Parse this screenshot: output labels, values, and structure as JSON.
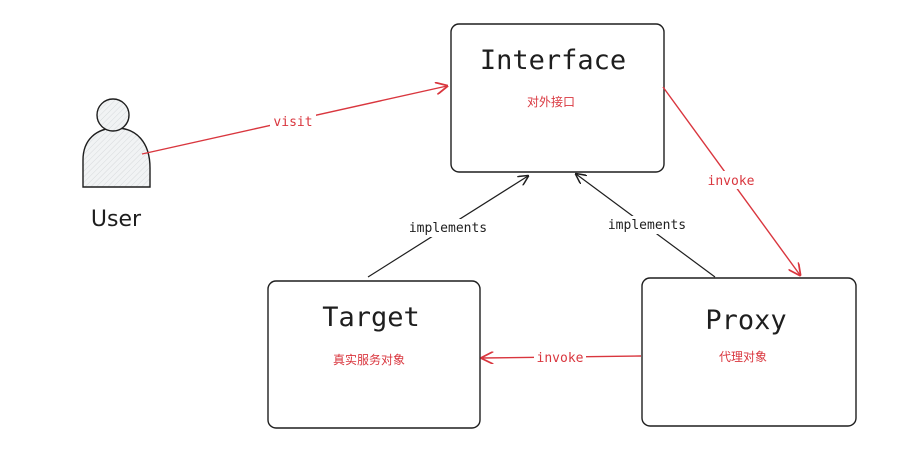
{
  "diagram": {
    "actor": {
      "label": "User"
    },
    "nodes": {
      "interface": {
        "title": "Interface",
        "subtitle": "对外接口"
      },
      "target": {
        "title": "Target",
        "subtitle": "真实服务对象"
      },
      "proxy": {
        "title": "Proxy",
        "subtitle": "代理对象"
      }
    },
    "edges": {
      "visit": {
        "label": "visit",
        "from": "User",
        "to": "Interface"
      },
      "invoke_interface_proxy": {
        "label": "invoke",
        "from": "Interface",
        "to": "Proxy"
      },
      "implements_target": {
        "label": "implements",
        "from": "Target",
        "to": "Interface"
      },
      "implements_proxy": {
        "label": "implements",
        "from": "Proxy",
        "to": "Interface"
      },
      "invoke_proxy_target": {
        "label": "invoke",
        "from": "Proxy",
        "to": "Target"
      }
    }
  },
  "colors": {
    "stroke": "#1e1e1e",
    "accent": "#d9363e",
    "background": "#ffffff"
  }
}
